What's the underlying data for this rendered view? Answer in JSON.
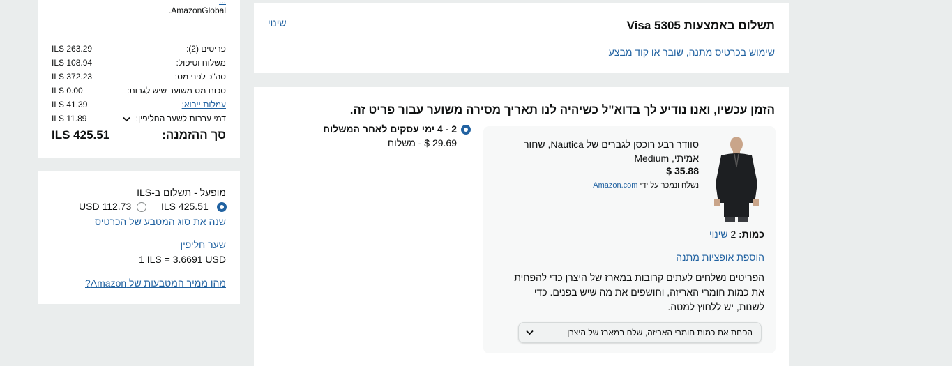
{
  "summary": {
    "top_note_link": "...",
    "top_note_text": "AmazonGlobal.",
    "rows": [
      {
        "label": "פריטים (2):",
        "value": "ILS 263.29"
      },
      {
        "label": "משלוח וטיפול:",
        "value": "ILS 108.94"
      },
      {
        "label": "סה\"כ לפני מס:",
        "value": "ILS 372.23"
      },
      {
        "label": "סכום מס משוער שיש לגבות:",
        "value": "ILS 0.00"
      },
      {
        "label": "עמלות ייבוא:",
        "value": "ILS 41.39"
      },
      {
        "label": "דמי ערבות לשער החליפין:",
        "value": "ILS 11.89"
      }
    ],
    "total_label": "סך ההזמנה:",
    "total_value": "ILS 425.51"
  },
  "currency": {
    "title": "מופעל - תשלום ב-ILS",
    "option_ils": "ILS 425.51",
    "option_usd": "USD 112.73",
    "selected": "ILS",
    "change_link": "שנה את סוג המטבע של הכרטיס",
    "rate_label": "שער חליפין",
    "rate_value": "1 ILS = 3.6691 USD",
    "what_link": "מהו ממיר המטבעות של Amazon?"
  },
  "payment": {
    "title": "תשלום באמצעות Visa 5305",
    "change": "שינוי",
    "gift_link": "שימוש בכרטיס מתנה, שובר או קוד מבצע"
  },
  "shipment": {
    "heading": "הזמן עכשיו, ואנו נודיע לך בדוא\"ל כשיהיה לנו תאריך מסירה משוער עבור פריט זה.",
    "item": {
      "title": "סוודר רבע רוכסן לגברים של Nautica, שחור אמיתי, Medium",
      "price": "$ 35.88",
      "seller_prefix": "נשלח ונמכר על ידי",
      "seller": "Amazon.com",
      "qty_label": "כמות:",
      "qty_value": "2",
      "qty_change": "שינוי",
      "gift_options": "הוספת אופציות מתנה",
      "pack_text": "הפריטים נשלחים לעתים קרובות במארז של היצרן כדי להפחית את כמות חומרי האריזה, וחושפים את מה שיש בפנים. כדי לשנות, יש ללחוץ למטה.",
      "pack_select": "הפחת את כמות חומרי האריזה, שלח במארז של היצרן"
    },
    "shipping_option": {
      "label": "2 - 4 ימי עסקים לאחר המשלוח",
      "cost": "29.69 $ - משלוח"
    }
  },
  "colors": {
    "link": "#2162a1",
    "background": "#eaeded",
    "card": "#f7f8f8"
  }
}
